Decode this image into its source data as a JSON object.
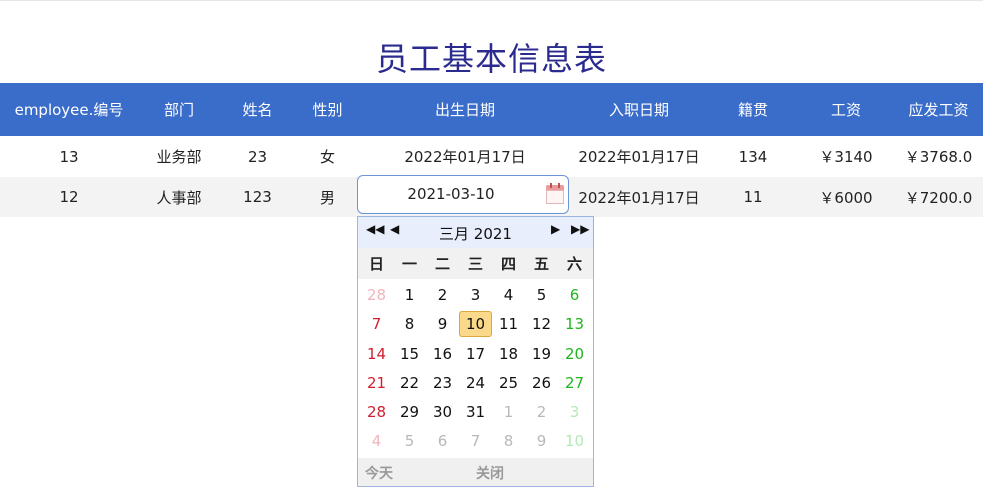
{
  "page": {
    "title": "员工基本信息表"
  },
  "table": {
    "headers": [
      "employee.编号",
      "部门",
      "姓名",
      "性别",
      "出生日期",
      "入职日期",
      "籍贯",
      "工资",
      "应发工资"
    ],
    "rows": [
      [
        "13",
        "业务部",
        "23",
        "女",
        "2022年01月17日",
        "2022年01月17日",
        "134",
        "￥3140",
        "￥3768.0"
      ],
      [
        "12",
        "人事部",
        "123",
        "男",
        "",
        "2022年01月17日",
        "11",
        "￥6000",
        "￥7200.0"
      ]
    ]
  },
  "editor": {
    "value": "2021-03-10",
    "icon": "calendar-icon"
  },
  "datepicker": {
    "month_label": "三月 2021",
    "weekdays": [
      "日",
      "一",
      "二",
      "三",
      "四",
      "五",
      "六"
    ],
    "weeks": [
      [
        "28",
        "1",
        "2",
        "3",
        "4",
        "5",
        "6"
      ],
      [
        "7",
        "8",
        "9",
        "10",
        "11",
        "12",
        "13"
      ],
      [
        "14",
        "15",
        "16",
        "17",
        "18",
        "19",
        "20"
      ],
      [
        "21",
        "22",
        "23",
        "24",
        "25",
        "26",
        "27"
      ],
      [
        "28",
        "29",
        "30",
        "31",
        "1",
        "2",
        "3"
      ],
      [
        "4",
        "5",
        "6",
        "7",
        "8",
        "9",
        "10"
      ]
    ],
    "selected_day": "10",
    "today_label": "今天",
    "close_label": "关闭",
    "colors": {
      "sunday": "#d01f2f",
      "saturday": "#1fb51f",
      "selected": "#fbd98b",
      "header": "#3a6cc9"
    }
  }
}
